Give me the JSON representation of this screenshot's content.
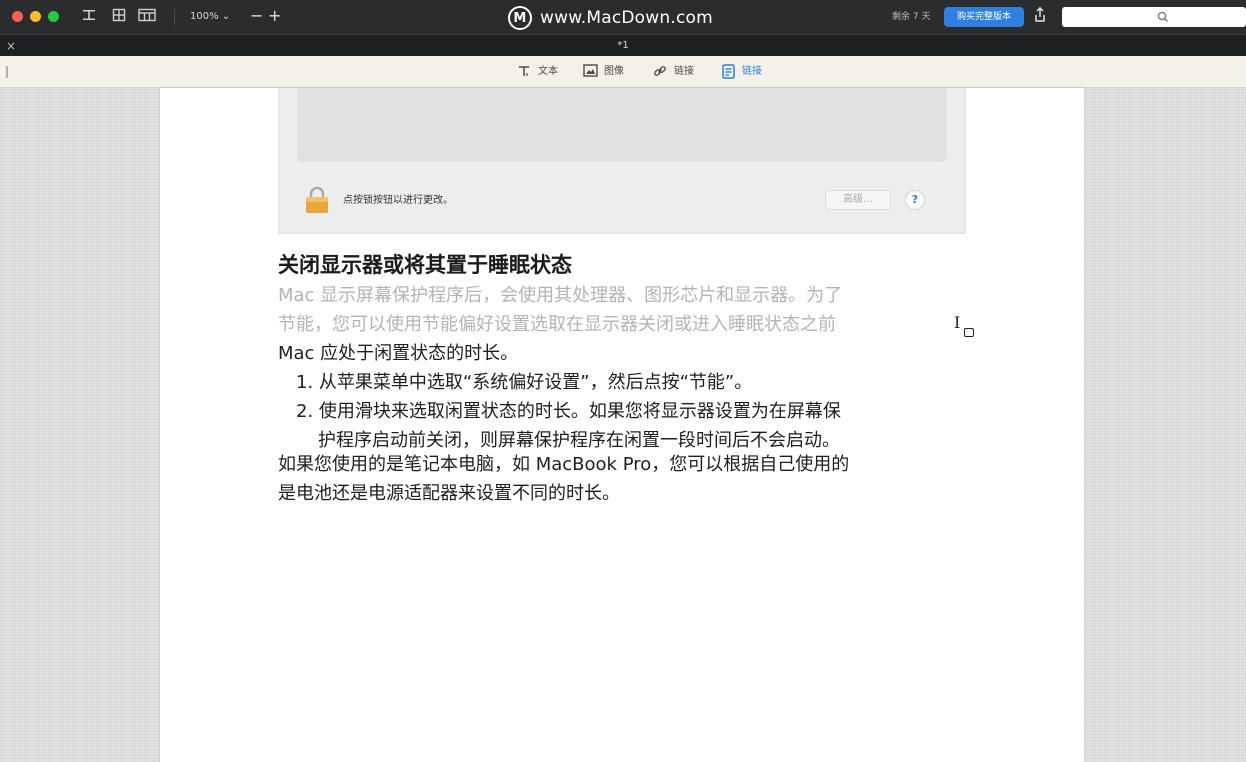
{
  "window": {
    "zoom_label": "100% ⌄",
    "zoom_out": "−",
    "zoom_in": "+",
    "watermark_text": "www.MacDown.com",
    "watermark_logo": "M",
    "trial_text": "剩余 7 天",
    "buy_label": "购买完整版本",
    "search_placeholder": ""
  },
  "tab": {
    "close": "×",
    "title": "*1"
  },
  "edit_toolbar": {
    "items": [
      {
        "label": "文本",
        "icon": "text-icon",
        "glyph": "T̲"
      },
      {
        "label": "图像",
        "icon": "image-icon",
        "glyph": "▣"
      },
      {
        "label": "链接",
        "icon": "link-icon",
        "glyph": "∂"
      },
      {
        "label": "链接",
        "icon": "form-icon",
        "glyph": "▤"
      }
    ]
  },
  "embed": {
    "lock_text": "点按锁按钮以进行更改。",
    "advanced_label": "高级…",
    "help_label": "?"
  },
  "document": {
    "heading": "关闭显示器或将其置于睡眠状态",
    "faded_lines": [
      "Mac 显示屏幕保护程序后，会使用其处理器、图形芯片和显示器。为了",
      "节能，您可以使用节能偏好设置选取在显示器关闭或进入睡眠状态之前"
    ],
    "line3": "Mac 应处于闲置状态的时长。",
    "list": [
      {
        "num": "1.",
        "lines": [
          "从苹果菜单中选取“系统偏好设置”，然后点按“节能”。"
        ]
      },
      {
        "num": "2.",
        "lines": [
          "使用滑块来选取闲置状态的时长。如果您将显示器设置为在屏幕保",
          "护程序启动前关闭，则屏幕保护程序在闲置一段时间后不会启动。"
        ]
      }
    ],
    "closing_lines": [
      "如果您使用的是笔记本电脑，如 MacBook Pro，您可以根据自己使用的",
      "是电池还是电源适配器来设置不同的时长。"
    ],
    "cursor_glyph": "I"
  },
  "colors": {
    "titlebar": "#2b2c2e",
    "accent": "#2f7fe0",
    "toolbar_bg": "#f4f1e8",
    "faded_text": "#b4b4b4"
  }
}
